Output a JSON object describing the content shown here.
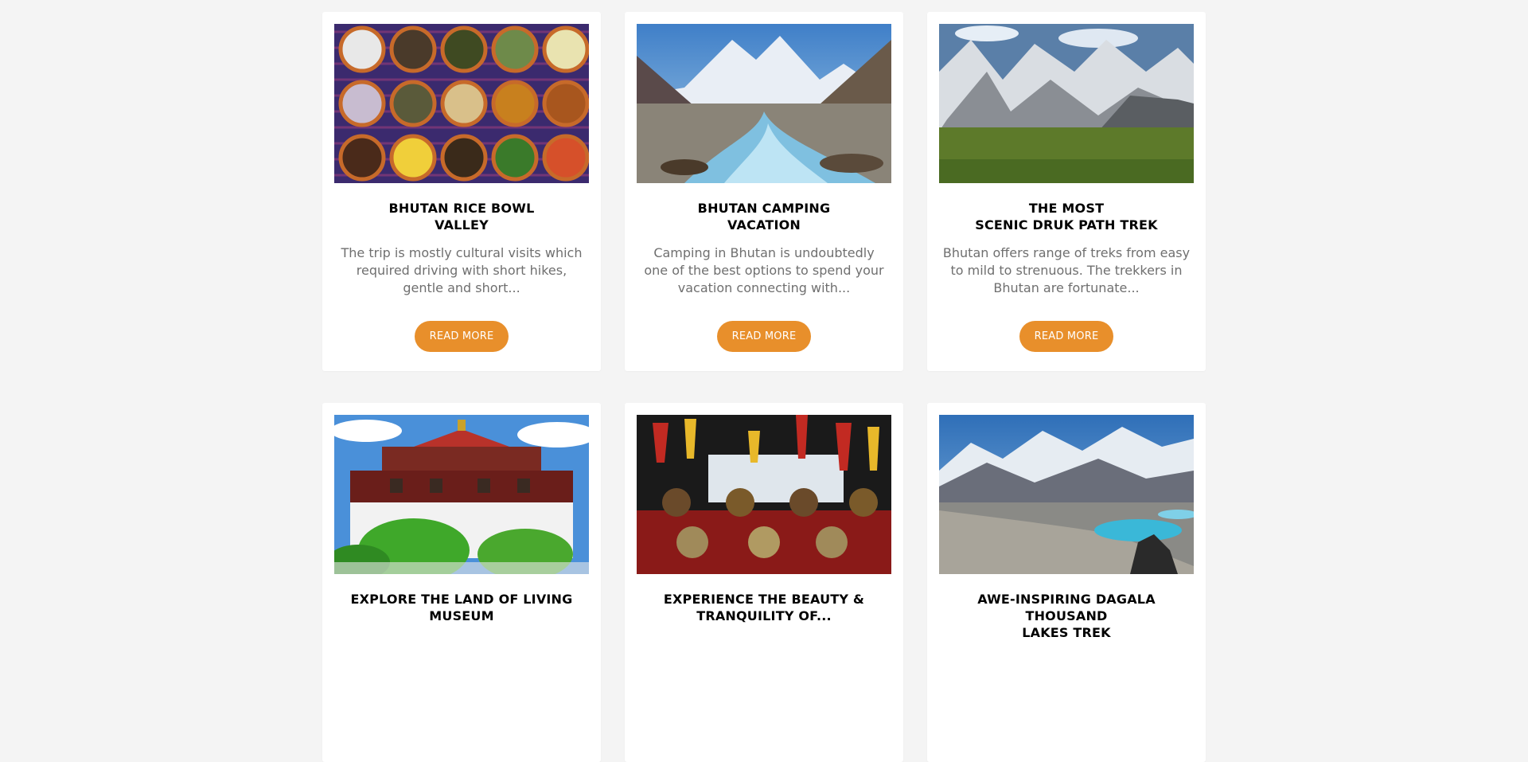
{
  "theme": {
    "page_background": "#f4f4f4",
    "card_background": "#ffffff",
    "button_color": "#e88f2b",
    "title_color": "#000000",
    "text_color": "#6f6f6f"
  },
  "cards": [
    {
      "image": "bhutanese-food-bowls-photo",
      "title": "BHUTAN RICE BOWL\nVALLEY",
      "description": "The trip is mostly cultural visits which required driving with short hikes, gentle and short...",
      "button_label": "READ MORE"
    },
    {
      "image": "mountain-river-camping-photo",
      "title": "BHUTAN CAMPING\nVACATION",
      "description": "Camping in Bhutan is undoubtedly one of the best options to spend your vacation connecting with...",
      "button_label": "READ MORE"
    },
    {
      "image": "snowy-peaks-meadow-photo",
      "title": "THE MOST\nSCENIC DRUK PATH TREK",
      "description": "Bhutan offers range of treks from easy to mild to strenuous. The trekkers in Bhutan are fortunate...",
      "button_label": "READ MORE"
    },
    {
      "image": "national-museum-tower-photo",
      "title": "EXPLORE THE LAND OF LIVING\nMUSEUM",
      "description": "",
      "button_label": ""
    },
    {
      "image": "festival-mask-dancers-photo",
      "title": "EXPERIENCE THE BEAUTY &\nTRANQUILITY OF...",
      "description": "",
      "button_label": ""
    },
    {
      "image": "mountain-lakes-valley-photo",
      "title": "AWE-INSPIRING DAGALA THOUSAND\nLAKES TREK",
      "description": "",
      "button_label": ""
    }
  ]
}
